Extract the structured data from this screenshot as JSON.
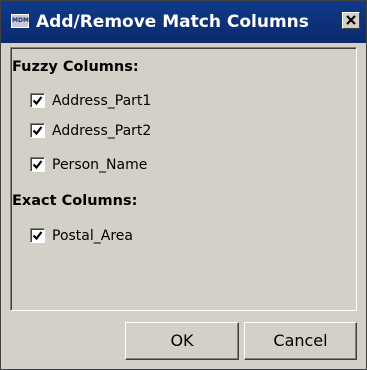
{
  "window": {
    "title": "Add/Remove Match Columns",
    "icon": "mdm-app-icon",
    "icon_text": "MDM",
    "close_glyph": "✕"
  },
  "fuzzy": {
    "header": "Fuzzy Columns:",
    "items": [
      {
        "label": "Address_Part1",
        "checked": true
      },
      {
        "label": "Address_Part2",
        "checked": true
      },
      {
        "label": "Person_Name",
        "checked": true
      }
    ]
  },
  "exact": {
    "header": "Exact Columns:",
    "items": [
      {
        "label": "Postal_Area",
        "checked": true
      }
    ]
  },
  "buttons": {
    "ok": "OK",
    "cancel": "Cancel"
  }
}
